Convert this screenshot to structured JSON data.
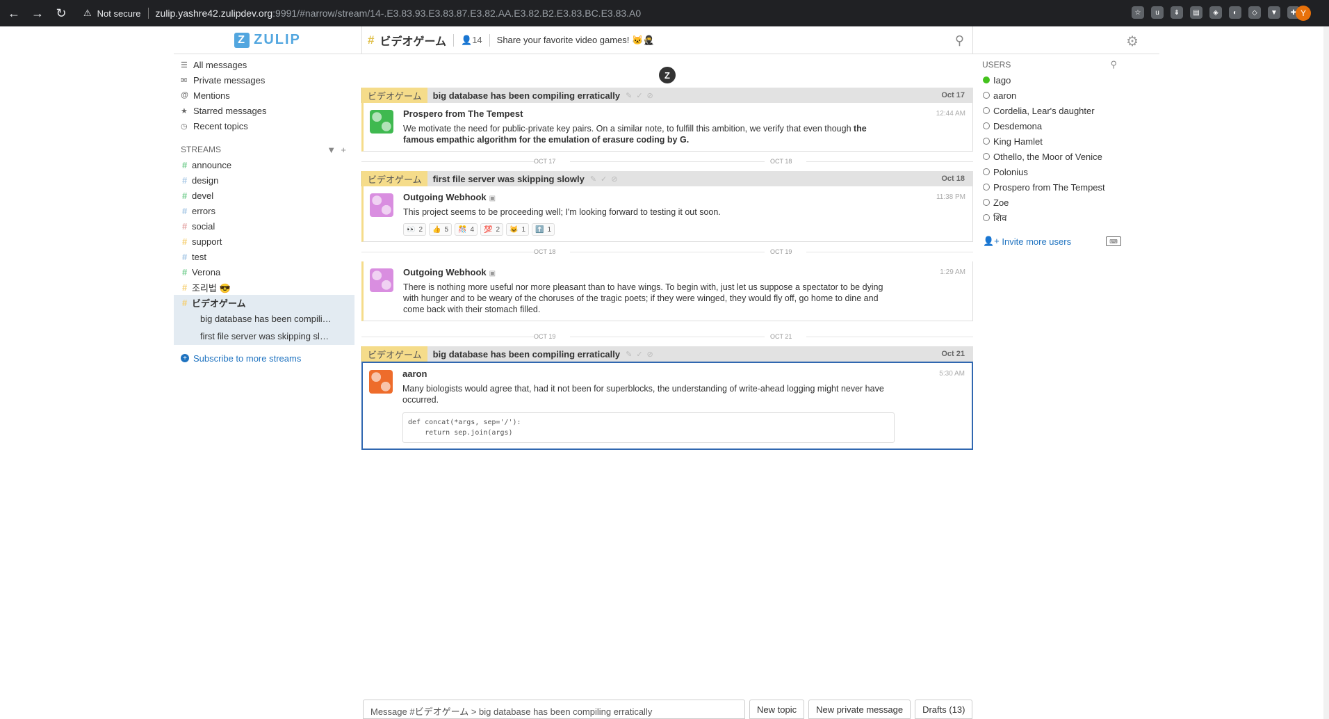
{
  "browser": {
    "security": "Not secure",
    "url_host": "zulip.yashre42.zulipdev.org",
    "url_rest": ":9991/#narrow/stream/14-.E3.83.93.E3.83.87.E3.82.AA.E3.82.B2.E3.83.BC.E3.83.A0",
    "profile_initial": "Y"
  },
  "app": {
    "logo": "ZULIP",
    "logo_mark": "Z"
  },
  "stream_header": {
    "name": "ビデオゲーム",
    "subscribers": "14",
    "description": "Share your favorite video games! 🐱🥷"
  },
  "left": {
    "nav": [
      {
        "icon": "all-messages-icon",
        "glyph": "☰",
        "label": "All messages"
      },
      {
        "icon": "private-messages-icon",
        "glyph": "✉",
        "label": "Private messages"
      },
      {
        "icon": "mentions-icon",
        "glyph": "@",
        "label": "Mentions"
      },
      {
        "icon": "star-icon",
        "glyph": "★",
        "label": "Starred messages"
      },
      {
        "icon": "clock-icon",
        "glyph": "◷",
        "label": "Recent topics"
      }
    ],
    "streams_header": "STREAMS",
    "streams": [
      {
        "name": "announce",
        "color": "#76ce90"
      },
      {
        "name": "design",
        "color": "#a6c7e5"
      },
      {
        "name": "devel",
        "color": "#76ce90"
      },
      {
        "name": "errors",
        "color": "#a6c7e5"
      },
      {
        "name": "social",
        "color": "#e4a5a5"
      },
      {
        "name": "support",
        "color": "#f5ce6e"
      },
      {
        "name": "test",
        "color": "#a6c7e5"
      },
      {
        "name": "Verona",
        "color": "#76ce90"
      },
      {
        "name": "조리법 😎",
        "color": "#f5ce6e"
      },
      {
        "name": "ビデオゲーム",
        "color": "#f5ce6e"
      }
    ],
    "topics": [
      "big database has been compili…",
      "first file server was skipping sl…"
    ],
    "subscribe": "Subscribe to more streams"
  },
  "messages": {
    "loading_mark": "Z",
    "groups": [
      {
        "stream": "ビデオゲーム",
        "topic": "big database has been compiling erratically",
        "date": "Oct 17",
        "msgs": [
          {
            "sender": "Prospero from The Tempest",
            "time": "12:44 AM",
            "text": "We motivate the need for public-private key pairs. On a similar note, to fulfill this ambition, we verify that even though ",
            "bold": "the famous empathic algorithm for the emulation of erasure coding by G."
          }
        ]
      },
      {
        "stream": "ビデオゲーム",
        "topic": "first file server was skipping slowly",
        "date": "Oct 18",
        "msgs": [
          {
            "sender": "Outgoing Webhook",
            "time": "11:38 PM",
            "text": "This project seems to be proceeding well; I'm looking forward to testing it out soon.",
            "reactions": [
              {
                "emoji": "👀",
                "count": "2"
              },
              {
                "emoji": "👍",
                "count": "5"
              },
              {
                "emoji": "🎊",
                "count": "4"
              },
              {
                "emoji": "💯",
                "count": "2"
              },
              {
                "emoji": "😺",
                "count": "1"
              },
              {
                "emoji": "⬆️",
                "count": "1"
              }
            ]
          },
          {
            "sender": "Outgoing Webhook",
            "time": "1:29 AM",
            "text": "There is nothing more useful nor more pleasant than to have wings. To begin with, just let us suppose a spectator to be dying with hunger and to be weary of the choruses of the tragic poets; if they were winged, they would fly off, go home to dine and come back with their stomach filled."
          }
        ]
      },
      {
        "stream": "ビデオゲーム",
        "topic": "big database has been compiling erratically",
        "date": "Oct 21",
        "msgs": [
          {
            "sender": "aaron",
            "time": "5:30 AM",
            "text": "Many biologists would agree that, had it not been for superblocks, the understanding of write-ahead logging might never have occurred.",
            "code": "def concat(*args, sep='/'):\n    return sep.join(args)"
          }
        ]
      }
    ],
    "separators": [
      {
        "left": "OCT 17",
        "right": "OCT 18"
      },
      {
        "left": "OCT 18",
        "right": "OCT 19"
      },
      {
        "left": "OCT 19",
        "right": "OCT 21"
      }
    ]
  },
  "right": {
    "users_header": "USERS",
    "users": [
      {
        "name": "Iago",
        "active": true
      },
      {
        "name": "aaron",
        "active": false
      },
      {
        "name": "Cordelia, Lear's daughter",
        "active": false
      },
      {
        "name": "Desdemona",
        "active": false
      },
      {
        "name": "King Hamlet",
        "active": false
      },
      {
        "name": "Othello, the Moor of Venice",
        "active": false
      },
      {
        "name": "Polonius",
        "active": false
      },
      {
        "name": "Prospero from The Tempest",
        "active": false
      },
      {
        "name": "Zoe",
        "active": false
      },
      {
        "name": "शिव",
        "active": false
      }
    ],
    "invite": "Invite more users"
  },
  "compose": {
    "placeholder": "Message #ビデオゲーム > big database has been compiling erratically",
    "new_topic": "New topic",
    "new_pm": "New private message",
    "drafts": "Drafts (13)"
  }
}
